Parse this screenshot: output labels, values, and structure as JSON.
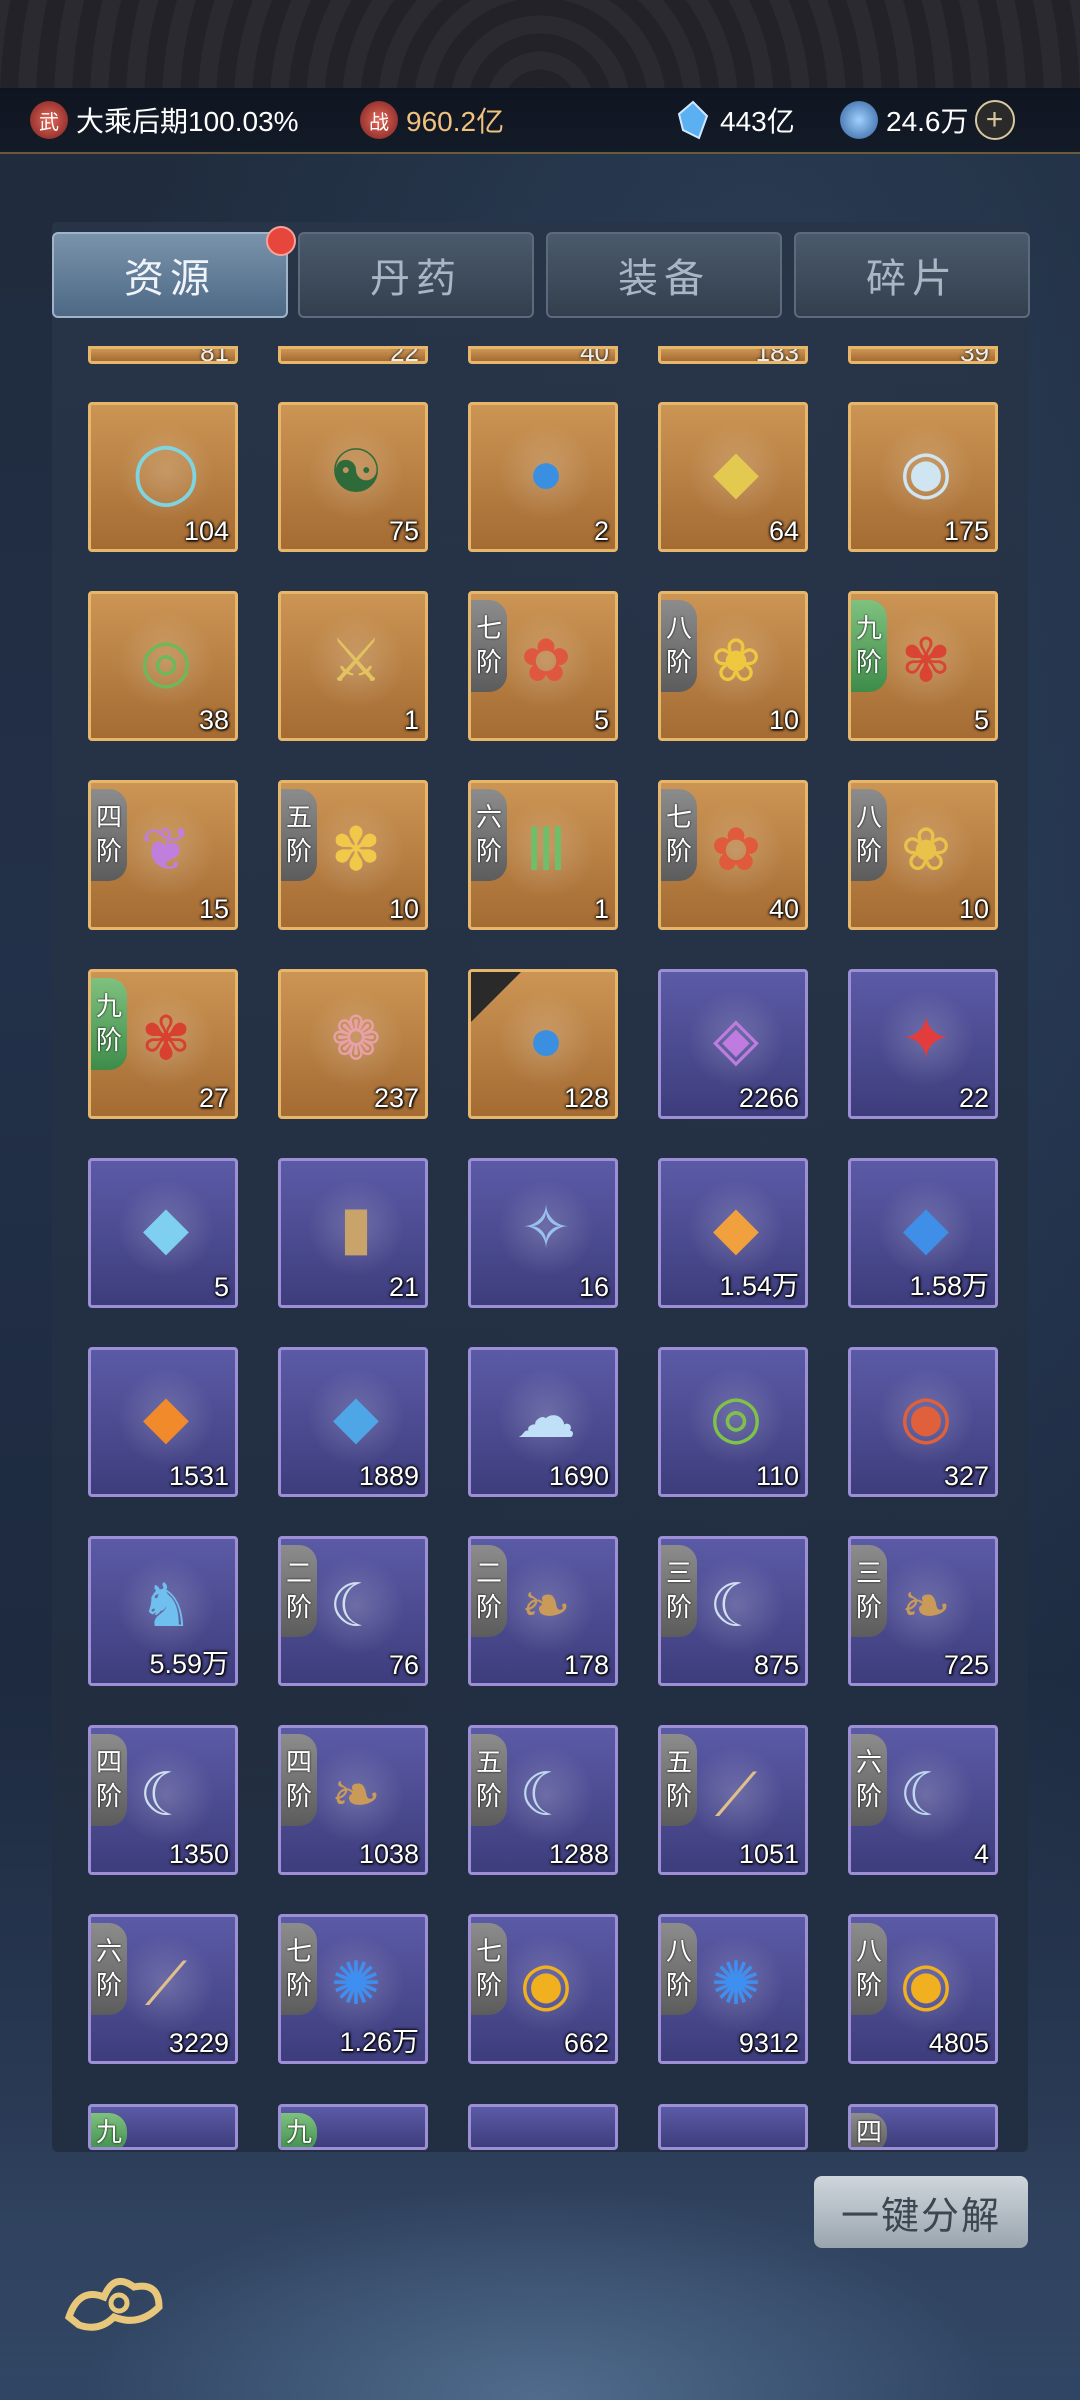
{
  "status": {
    "realm": "大乘后期100.03%",
    "power": "960.2亿",
    "crystal": "443亿",
    "coin": "24.6万",
    "realm_icon": "武",
    "power_icon": "战"
  },
  "tabs": [
    {
      "label": "资源",
      "active": true,
      "badge": true
    },
    {
      "label": "丹药",
      "active": false
    },
    {
      "label": "装备",
      "active": false
    },
    {
      "label": "碎片",
      "active": false
    }
  ],
  "partial_top_counts": [
    "81",
    "22",
    "40",
    "183",
    "39"
  ],
  "items": [
    {
      "count": "104",
      "bg": "gold",
      "icon": "jade-ring-icon",
      "glyph": "◯",
      "color": "#7fd4e0"
    },
    {
      "count": "75",
      "bg": "gold",
      "icon": "talisman-icon",
      "glyph": "☯",
      "color": "#2f6b3a"
    },
    {
      "count": "2",
      "bg": "gold",
      "icon": "water-orb-icon",
      "glyph": "●",
      "color": "#3b8fe0"
    },
    {
      "count": "64",
      "bg": "gold",
      "icon": "gold-ore-icon",
      "glyph": "◆",
      "color": "#e3c94f"
    },
    {
      "count": "175",
      "bg": "gold",
      "icon": "pearl-icon",
      "glyph": "◉",
      "color": "#cfe6f2"
    },
    {
      "count": "38",
      "bg": "gold",
      "icon": "green-jade-icon",
      "glyph": "◎",
      "color": "#6fb85a"
    },
    {
      "count": "1",
      "bg": "gold",
      "icon": "golden-sword-icon",
      "glyph": "⚔",
      "color": "#e2c35f"
    },
    {
      "count": "5",
      "bg": "gold",
      "icon": "lingzhi-pot-icon",
      "glyph": "✿",
      "color": "#e0573f",
      "tier": "七阶"
    },
    {
      "count": "10",
      "bg": "gold",
      "icon": "flower-pot-icon",
      "glyph": "❀",
      "color": "#f0c83f",
      "tier": "八阶"
    },
    {
      "count": "5",
      "bg": "gold",
      "icon": "red-tree-pot-icon",
      "glyph": "✾",
      "color": "#d94433",
      "tier": "九阶",
      "tier_green": true
    },
    {
      "count": "15",
      "bg": "gold",
      "icon": "purple-herb-icon",
      "glyph": "❦",
      "color": "#c07fdc",
      "tier": "四阶"
    },
    {
      "count": "10",
      "bg": "gold",
      "icon": "yellow-flower-icon",
      "glyph": "✽",
      "color": "#f2c84a",
      "tier": "五阶"
    },
    {
      "count": "1",
      "bg": "gold",
      "icon": "bamboo-icon",
      "glyph": "Ⅲ",
      "color": "#6fbf6a",
      "tier": "六阶"
    },
    {
      "count": "40",
      "bg": "gold",
      "icon": "lingzhi-icon",
      "glyph": "✿",
      "color": "#e05a3c",
      "tier": "七阶"
    },
    {
      "count": "10",
      "bg": "gold",
      "icon": "star-flower-icon",
      "glyph": "❀",
      "color": "#e9c24a",
      "tier": "八阶"
    },
    {
      "count": "27",
      "bg": "gold",
      "icon": "red-tree-icon",
      "glyph": "✾",
      "color": "#d8412f",
      "tier": "九阶",
      "tier_green": true
    },
    {
      "count": "237",
      "bg": "gold",
      "icon": "plum-branch-icon",
      "glyph": "❁",
      "color": "#e9a0a8"
    },
    {
      "count": "128",
      "bg": "gold",
      "icon": "water-orb-icon",
      "glyph": "●",
      "color": "#3b8fe0",
      "corner": true
    },
    {
      "count": "2266",
      "bg": "purple",
      "icon": "mirror-icon",
      "glyph": "◈",
      "color": "#c07be0"
    },
    {
      "count": "22",
      "bg": "purple",
      "icon": "red-badge-icon",
      "glyph": "✦",
      "color": "#e23c3c"
    },
    {
      "count": "5",
      "bg": "purple",
      "icon": "blue-crystal-icon",
      "glyph": "◆",
      "color": "#7fd0f0"
    },
    {
      "count": "21",
      "bg": "purple",
      "icon": "coffin-icon",
      "glyph": "▮",
      "color": "#c8a46a"
    },
    {
      "count": "16",
      "bg": "purple",
      "icon": "scroll-icon",
      "glyph": "✧",
      "color": "#9ac0f0"
    },
    {
      "count": "1.54万",
      "bg": "purple",
      "icon": "orange-rune-stone-icon",
      "glyph": "◆",
      "color": "#f0a03c"
    },
    {
      "count": "1.58万",
      "bg": "purple",
      "icon": "blue-rune-stone-icon",
      "glyph": "◆",
      "color": "#3f8fe8"
    },
    {
      "count": "1531",
      "bg": "purple",
      "icon": "fire-rune-crystal-icon",
      "glyph": "◆",
      "color": "#f08a2a"
    },
    {
      "count": "1889",
      "bg": "purple",
      "icon": "ice-rune-crystal-icon",
      "glyph": "◆",
      "color": "#4fa6e6"
    },
    {
      "count": "1690",
      "bg": "purple",
      "icon": "cloud-swirl-icon",
      "glyph": "☁",
      "color": "#bfe0f6"
    },
    {
      "count": "110",
      "bg": "purple",
      "icon": "green-swirl-icon",
      "glyph": "◎",
      "color": "#7fc14a"
    },
    {
      "count": "327",
      "bg": "purple",
      "icon": "cosmic-orb-icon",
      "glyph": "◉",
      "color": "#e0603c"
    },
    {
      "count": "5.59万",
      "bg": "purple",
      "icon": "spirit-deer-icon",
      "glyph": "♞",
      "color": "#6fc0ef"
    },
    {
      "count": "76",
      "bg": "purple",
      "icon": "claw-icon",
      "glyph": "☾",
      "color": "#cfe0ee",
      "tier": "二阶"
    },
    {
      "count": "178",
      "bg": "purple",
      "icon": "fur-icon",
      "glyph": "❧",
      "color": "#c99a58",
      "tier": "二阶"
    },
    {
      "count": "875",
      "bg": "purple",
      "icon": "claw-icon",
      "glyph": "☾",
      "color": "#cfe0ee",
      "tier": "三阶"
    },
    {
      "count": "725",
      "bg": "purple",
      "icon": "fur-icon",
      "glyph": "❧",
      "color": "#c99a58",
      "tier": "三阶"
    },
    {
      "count": "1350",
      "bg": "purple",
      "icon": "claw-icon",
      "glyph": "☾",
      "color": "#cfe0ee",
      "tier": "四阶"
    },
    {
      "count": "1038",
      "bg": "purple",
      "icon": "fur-icon",
      "glyph": "❧",
      "color": "#c99a58",
      "tier": "四阶"
    },
    {
      "count": "1288",
      "bg": "purple",
      "icon": "triple-claw-icon",
      "glyph": "☾",
      "color": "#bfd8ee",
      "tier": "五阶"
    },
    {
      "count": "1051",
      "bg": "purple",
      "icon": "bone-icon",
      "glyph": "⟋",
      "color": "#e0c08a",
      "tier": "五阶"
    },
    {
      "count": "4",
      "bg": "purple",
      "icon": "triple-claw-icon",
      "glyph": "☾",
      "color": "#bfd8ee",
      "tier": "六阶"
    },
    {
      "count": "3229",
      "bg": "purple",
      "icon": "bone-icon",
      "glyph": "⟋",
      "color": "#e0c08a",
      "tier": "六阶"
    },
    {
      "count": "1.26万",
      "bg": "purple",
      "icon": "blue-flame-spirit-icon",
      "glyph": "✺",
      "color": "#3f8ff0",
      "tier": "七阶"
    },
    {
      "count": "662",
      "bg": "purple",
      "icon": "fire-orb-icon",
      "glyph": "◉",
      "color": "#f0b020",
      "tier": "七阶"
    },
    {
      "count": "9312",
      "bg": "purple",
      "icon": "blue-flame-spirit-icon",
      "glyph": "✺",
      "color": "#3f8ff0",
      "tier": "八阶"
    },
    {
      "count": "4805",
      "bg": "purple",
      "icon": "fire-orb-icon",
      "glyph": "◉",
      "color": "#f0b020",
      "tier": "八阶"
    }
  ],
  "partial_bottom": [
    {
      "bg": "purple",
      "tier": "九",
      "tier_green": true
    },
    {
      "bg": "purple",
      "tier": "九",
      "tier_green": true
    },
    {
      "bg": "purple"
    },
    {
      "bg": "purple"
    },
    {
      "bg": "purple",
      "tier": "四"
    }
  ],
  "decompose_label": "一键分解"
}
